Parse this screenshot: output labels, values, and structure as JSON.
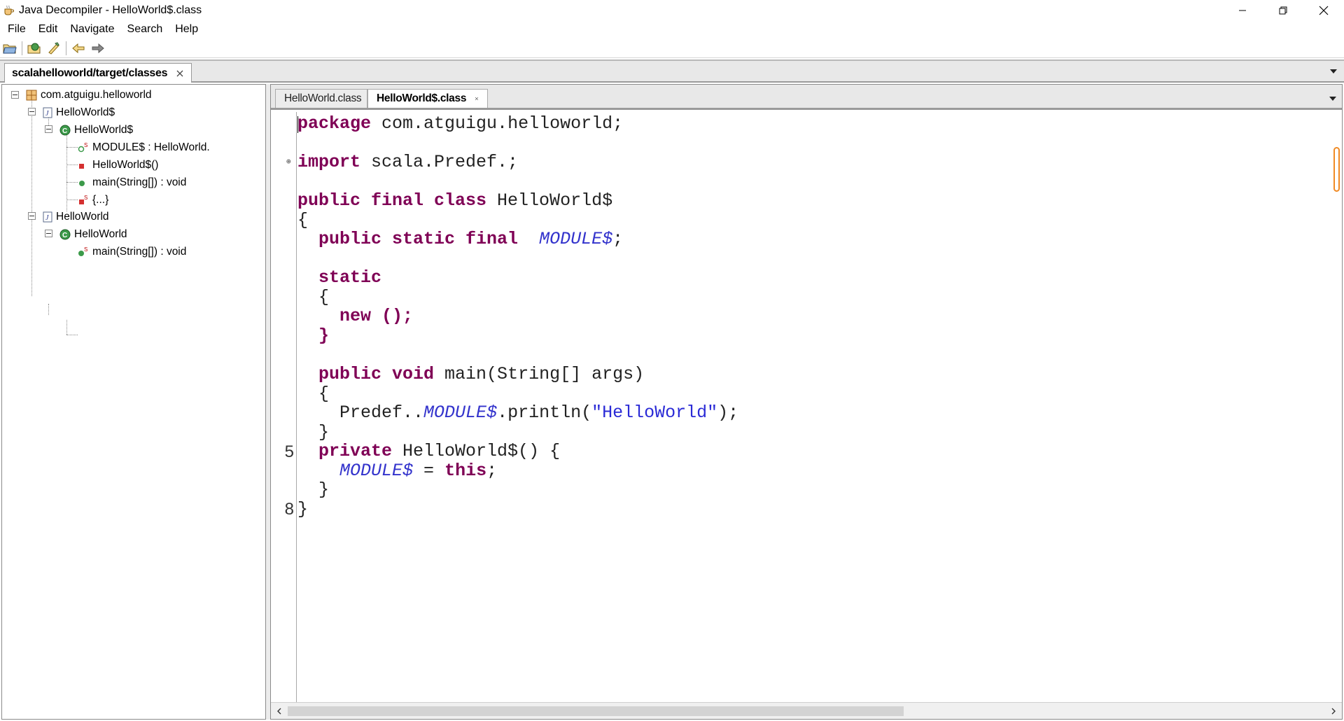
{
  "window": {
    "title": "Java Decompiler - HelloWorld$.class"
  },
  "menu": {
    "items": [
      "File",
      "Edit",
      "Navigate",
      "Search",
      "Help"
    ]
  },
  "toolbar": {
    "icons": [
      "open-file-icon",
      "open-type-icon",
      "search-type-icon",
      "back-arrow-icon",
      "forward-arrow-icon"
    ]
  },
  "outer_tab": {
    "label": "scalahelloworld/target/classes"
  },
  "tree": {
    "package": "com.atguigu.helloworld",
    "file1": "HelloWorld$",
    "class1": "HelloWorld$",
    "m_module": "MODULE$ : HelloWorld.",
    "m_ctor": "HelloWorld$()",
    "m_main1": "main(String[]) : void",
    "m_static": "{...}",
    "file2": "HelloWorld",
    "class2": "HelloWorld",
    "m_main2": "main(String[]) : void",
    "static_badge": "S"
  },
  "editor": {
    "tabs": [
      {
        "label": "HelloWorld.class",
        "active": false
      },
      {
        "label": "HelloWorld$.class",
        "active": true
      }
    ],
    "line_numbers": [
      "5",
      "8"
    ],
    "code": {
      "pkg_kw": "package",
      "pkg_name": " com.atguigu.helloworld;",
      "imp_kw": "import",
      "imp_name": " scala.Predef.;",
      "cls_kw": "public final class",
      "cls_name": " HelloWorld$",
      "brace_open": "{",
      "fld_kw": "  public static final",
      "fld_name": "  MODULE$",
      "semi": ";",
      "static_kw": "  static",
      "static_open": "  {",
      "new_kw": "    new ();",
      "static_close": "  }",
      "main_kw": "  public void",
      "main_sig": " main(String[] args)",
      "main_open": "  {",
      "call_a": "    Predef..",
      "call_b": "MODULE$",
      "call_c": ".println(",
      "call_str": "\"HelloWorld\"",
      "call_d": ");",
      "main_close": "  }",
      "priv_kw": "  private",
      "priv_sig": " HelloWorld$() {",
      "assign_a": "    ",
      "assign_b": "MODULE$",
      "assign_c": " = ",
      "assign_kw": "this",
      "assign_d": ";",
      "priv_close": "  }",
      "brace_close": "}"
    }
  },
  "colors": {
    "keyword": "#7f0055",
    "field": "#3333cc",
    "string": "#2a2ad6",
    "scroll_thumb": "#f08a24"
  }
}
